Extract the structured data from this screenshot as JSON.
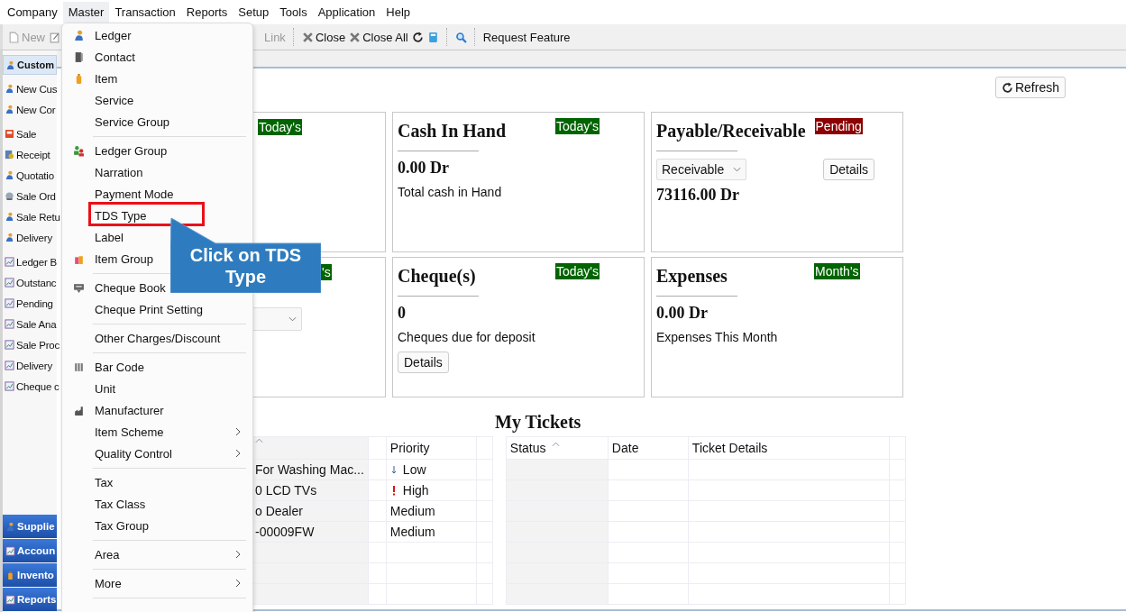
{
  "menubar": [
    {
      "label": "Company",
      "selected": false
    },
    {
      "label": "Master",
      "selected": true
    },
    {
      "label": "Transaction",
      "selected": false
    },
    {
      "label": "Reports",
      "selected": false
    },
    {
      "label": "Setup",
      "selected": false
    },
    {
      "label": "Tools",
      "selected": false
    },
    {
      "label": "Application",
      "selected": false
    },
    {
      "label": "Help",
      "selected": false
    }
  ],
  "toolbar": {
    "new": "New",
    "link": "Link",
    "close": "Close",
    "close_all": "Close All",
    "request_feature": "Request Feature"
  },
  "sidebar": {
    "header": {
      "label": "Custom",
      "selected": true
    },
    "groups": [
      [
        {
          "label": "New Cus",
          "kind": "person"
        },
        {
          "label": "New Cor",
          "kind": "person"
        }
      ],
      [
        {
          "label": "Sale",
          "kind": "sale"
        },
        {
          "label": "Receipt",
          "kind": "receipt"
        },
        {
          "label": "Quotatio",
          "kind": "person"
        },
        {
          "label": "Sale Ord",
          "kind": "order"
        },
        {
          "label": "Sale Retu",
          "kind": "person"
        },
        {
          "label": "Delivery",
          "kind": "person"
        }
      ],
      [
        {
          "label": "Ledger B",
          "kind": "report"
        },
        {
          "label": "Outstanc",
          "kind": "report"
        },
        {
          "label": "Pending",
          "kind": "report"
        },
        {
          "label": "Sale Ana",
          "kind": "report"
        },
        {
          "label": "Sale Proc",
          "kind": "report"
        },
        {
          "label": "Delivery",
          "kind": "report"
        },
        {
          "label": "Cheque c",
          "kind": "report"
        }
      ]
    ],
    "sections": [
      {
        "label": "Supplie",
        "kind": "person"
      },
      {
        "label": "Accoun",
        "kind": "report"
      },
      {
        "label": "Invento",
        "kind": "item"
      },
      {
        "label": "Reports",
        "kind": "report"
      }
    ]
  },
  "refresh_button": "Refresh",
  "cards": [
    {
      "badge": {
        "text": "Today's",
        "color": "#006400"
      }
    },
    {
      "title": "Cash In Hand",
      "badge": {
        "text": "Today's",
        "color": "#006400"
      },
      "value": "0.00 Dr",
      "description": "Total cash in Hand"
    },
    {
      "title": "Payable/Receivable",
      "badge": {
        "text": "Pending",
        "color": "#8b0000"
      },
      "select": "Receivable",
      "button": "Details",
      "value": "73116.00 Dr"
    },
    {
      "badge": {
        "text": "'s",
        "color": "#006400"
      },
      "dropdown": true
    },
    {
      "title": "Cheque(s)",
      "badge": {
        "text": "Today's",
        "color": "#006400"
      },
      "value": "0",
      "description": "Cheques due for deposit",
      "button": "Details"
    },
    {
      "title": "Expenses",
      "badge": {
        "text": "Month's",
        "color": "#006400"
      },
      "value": "0.00 Dr",
      "description": "Expenses This Month"
    }
  ],
  "tasks_table": {
    "columns": [
      "Priority"
    ],
    "rows": [
      {
        "column_1": "For Washing Mac...",
        "priority": "Low",
        "kind": "low"
      },
      {
        "column_1": "0 LCD TVs",
        "priority": "High",
        "kind": "high"
      },
      {
        "column_1": "o Dealer",
        "priority": "Medium",
        "kind": "medium"
      },
      {
        "column_1": "-00009FW",
        "priority": "Medium",
        "kind": "medium"
      }
    ]
  },
  "my_tickets": {
    "title": "My Tickets",
    "columns": [
      "Status",
      "Date",
      "Ticket Details"
    ]
  },
  "master_menu": [
    {
      "kind": "item",
      "label": "Ledger",
      "submenu": false,
      "highlighted": false
    },
    {
      "kind": "item",
      "label": "Contact",
      "submenu": false,
      "highlighted": false
    },
    {
      "kind": "item",
      "label": "Item",
      "submenu": false,
      "highlighted": false
    },
    {
      "kind": "item",
      "label": "Service",
      "submenu": false,
      "highlighted": false
    },
    {
      "kind": "item",
      "label": "Service Group",
      "submenu": false,
      "highlighted": false
    },
    {
      "kind": "separator"
    },
    {
      "kind": "item",
      "label": "Ledger Group",
      "submenu": false,
      "highlighted": false
    },
    {
      "kind": "item",
      "label": "Narration",
      "submenu": false,
      "highlighted": false
    },
    {
      "kind": "item",
      "label": "Payment Mode",
      "submenu": false,
      "highlighted": false
    },
    {
      "kind": "item",
      "label": "TDS Type",
      "submenu": false,
      "highlighted": true
    },
    {
      "kind": "item",
      "label": "Label",
      "submenu": false,
      "highlighted": false
    },
    {
      "kind": "item",
      "label": "Item Group",
      "highlighted": false
    },
    {
      "kind": "separator"
    },
    {
      "kind": "item",
      "label": "Cheque Book",
      "highlighted": false
    },
    {
      "kind": "item",
      "label": "Cheque Print Setting",
      "submenu": false,
      "highlighted": false
    },
    {
      "kind": "separator"
    },
    {
      "kind": "item",
      "label": "Other Charges/Discount",
      "submenu": false,
      "highlighted": false
    },
    {
      "kind": "separator"
    },
    {
      "kind": "item",
      "label": "Bar Code",
      "submenu": false,
      "highlighted": false
    },
    {
      "kind": "item",
      "label": "Unit",
      "submenu": false,
      "highlighted": false
    },
    {
      "kind": "item",
      "label": "Manufacturer",
      "submenu": false,
      "highlighted": false
    },
    {
      "kind": "item",
      "label": "Item Scheme",
      "submenu": true,
      "highlighted": false
    },
    {
      "kind": "item",
      "label": "Quality Control",
      "submenu": true,
      "highlighted": false
    },
    {
      "kind": "separator"
    },
    {
      "kind": "item",
      "label": "Tax",
      "submenu": false,
      "highlighted": false
    },
    {
      "kind": "item",
      "label": "Tax Class",
      "submenu": false,
      "highlighted": false
    },
    {
      "kind": "item",
      "label": "Tax Group",
      "submenu": false,
      "highlighted": false
    },
    {
      "kind": "separator"
    },
    {
      "kind": "item",
      "label": "Area",
      "submenu": true,
      "highlighted": false
    },
    {
      "kind": "separator"
    },
    {
      "kind": "item",
      "label": "More",
      "submenu": true,
      "highlighted": false
    },
    {
      "kind": "separator"
    }
  ],
  "callout": {
    "text": "Click on TDS Type"
  }
}
